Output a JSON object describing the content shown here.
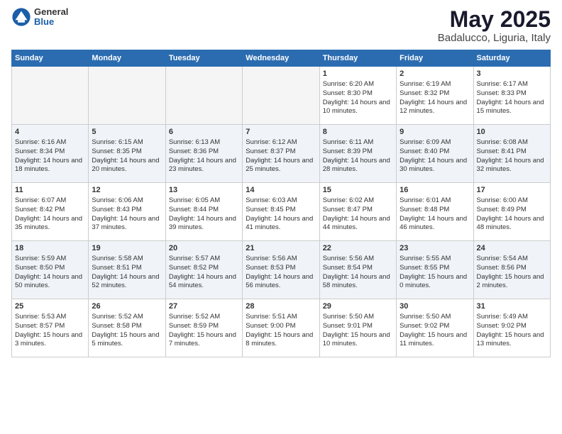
{
  "logo": {
    "general": "General",
    "blue": "Blue"
  },
  "title": "May 2025",
  "subtitle": "Badalucco, Liguria, Italy",
  "days_of_week": [
    "Sunday",
    "Monday",
    "Tuesday",
    "Wednesday",
    "Thursday",
    "Friday",
    "Saturday"
  ],
  "weeks": [
    [
      {
        "day": "",
        "empty": true
      },
      {
        "day": "",
        "empty": true
      },
      {
        "day": "",
        "empty": true
      },
      {
        "day": "",
        "empty": true
      },
      {
        "day": "1",
        "sunrise": "Sunrise: 6:20 AM",
        "sunset": "Sunset: 8:30 PM",
        "daylight": "Daylight: 14 hours and 10 minutes."
      },
      {
        "day": "2",
        "sunrise": "Sunrise: 6:19 AM",
        "sunset": "Sunset: 8:32 PM",
        "daylight": "Daylight: 14 hours and 12 minutes."
      },
      {
        "day": "3",
        "sunrise": "Sunrise: 6:17 AM",
        "sunset": "Sunset: 8:33 PM",
        "daylight": "Daylight: 14 hours and 15 minutes."
      }
    ],
    [
      {
        "day": "4",
        "sunrise": "Sunrise: 6:16 AM",
        "sunset": "Sunset: 8:34 PM",
        "daylight": "Daylight: 14 hours and 18 minutes."
      },
      {
        "day": "5",
        "sunrise": "Sunrise: 6:15 AM",
        "sunset": "Sunset: 8:35 PM",
        "daylight": "Daylight: 14 hours and 20 minutes."
      },
      {
        "day": "6",
        "sunrise": "Sunrise: 6:13 AM",
        "sunset": "Sunset: 8:36 PM",
        "daylight": "Daylight: 14 hours and 23 minutes."
      },
      {
        "day": "7",
        "sunrise": "Sunrise: 6:12 AM",
        "sunset": "Sunset: 8:37 PM",
        "daylight": "Daylight: 14 hours and 25 minutes."
      },
      {
        "day": "8",
        "sunrise": "Sunrise: 6:11 AM",
        "sunset": "Sunset: 8:39 PM",
        "daylight": "Daylight: 14 hours and 28 minutes."
      },
      {
        "day": "9",
        "sunrise": "Sunrise: 6:09 AM",
        "sunset": "Sunset: 8:40 PM",
        "daylight": "Daylight: 14 hours and 30 minutes."
      },
      {
        "day": "10",
        "sunrise": "Sunrise: 6:08 AM",
        "sunset": "Sunset: 8:41 PM",
        "daylight": "Daylight: 14 hours and 32 minutes."
      }
    ],
    [
      {
        "day": "11",
        "sunrise": "Sunrise: 6:07 AM",
        "sunset": "Sunset: 8:42 PM",
        "daylight": "Daylight: 14 hours and 35 minutes."
      },
      {
        "day": "12",
        "sunrise": "Sunrise: 6:06 AM",
        "sunset": "Sunset: 8:43 PM",
        "daylight": "Daylight: 14 hours and 37 minutes."
      },
      {
        "day": "13",
        "sunrise": "Sunrise: 6:05 AM",
        "sunset": "Sunset: 8:44 PM",
        "daylight": "Daylight: 14 hours and 39 minutes."
      },
      {
        "day": "14",
        "sunrise": "Sunrise: 6:03 AM",
        "sunset": "Sunset: 8:45 PM",
        "daylight": "Daylight: 14 hours and 41 minutes."
      },
      {
        "day": "15",
        "sunrise": "Sunrise: 6:02 AM",
        "sunset": "Sunset: 8:47 PM",
        "daylight": "Daylight: 14 hours and 44 minutes."
      },
      {
        "day": "16",
        "sunrise": "Sunrise: 6:01 AM",
        "sunset": "Sunset: 8:48 PM",
        "daylight": "Daylight: 14 hours and 46 minutes."
      },
      {
        "day": "17",
        "sunrise": "Sunrise: 6:00 AM",
        "sunset": "Sunset: 8:49 PM",
        "daylight": "Daylight: 14 hours and 48 minutes."
      }
    ],
    [
      {
        "day": "18",
        "sunrise": "Sunrise: 5:59 AM",
        "sunset": "Sunset: 8:50 PM",
        "daylight": "Daylight: 14 hours and 50 minutes."
      },
      {
        "day": "19",
        "sunrise": "Sunrise: 5:58 AM",
        "sunset": "Sunset: 8:51 PM",
        "daylight": "Daylight: 14 hours and 52 minutes."
      },
      {
        "day": "20",
        "sunrise": "Sunrise: 5:57 AM",
        "sunset": "Sunset: 8:52 PM",
        "daylight": "Daylight: 14 hours and 54 minutes."
      },
      {
        "day": "21",
        "sunrise": "Sunrise: 5:56 AM",
        "sunset": "Sunset: 8:53 PM",
        "daylight": "Daylight: 14 hours and 56 minutes."
      },
      {
        "day": "22",
        "sunrise": "Sunrise: 5:56 AM",
        "sunset": "Sunset: 8:54 PM",
        "daylight": "Daylight: 14 hours and 58 minutes."
      },
      {
        "day": "23",
        "sunrise": "Sunrise: 5:55 AM",
        "sunset": "Sunset: 8:55 PM",
        "daylight": "Daylight: 15 hours and 0 minutes."
      },
      {
        "day": "24",
        "sunrise": "Sunrise: 5:54 AM",
        "sunset": "Sunset: 8:56 PM",
        "daylight": "Daylight: 15 hours and 2 minutes."
      }
    ],
    [
      {
        "day": "25",
        "sunrise": "Sunrise: 5:53 AM",
        "sunset": "Sunset: 8:57 PM",
        "daylight": "Daylight: 15 hours and 3 minutes."
      },
      {
        "day": "26",
        "sunrise": "Sunrise: 5:52 AM",
        "sunset": "Sunset: 8:58 PM",
        "daylight": "Daylight: 15 hours and 5 minutes."
      },
      {
        "day": "27",
        "sunrise": "Sunrise: 5:52 AM",
        "sunset": "Sunset: 8:59 PM",
        "daylight": "Daylight: 15 hours and 7 minutes."
      },
      {
        "day": "28",
        "sunrise": "Sunrise: 5:51 AM",
        "sunset": "Sunset: 9:00 PM",
        "daylight": "Daylight: 15 hours and 8 minutes."
      },
      {
        "day": "29",
        "sunrise": "Sunrise: 5:50 AM",
        "sunset": "Sunset: 9:01 PM",
        "daylight": "Daylight: 15 hours and 10 minutes."
      },
      {
        "day": "30",
        "sunrise": "Sunrise: 5:50 AM",
        "sunset": "Sunset: 9:02 PM",
        "daylight": "Daylight: 15 hours and 11 minutes."
      },
      {
        "day": "31",
        "sunrise": "Sunrise: 5:49 AM",
        "sunset": "Sunset: 9:02 PM",
        "daylight": "Daylight: 15 hours and 13 minutes."
      }
    ]
  ]
}
